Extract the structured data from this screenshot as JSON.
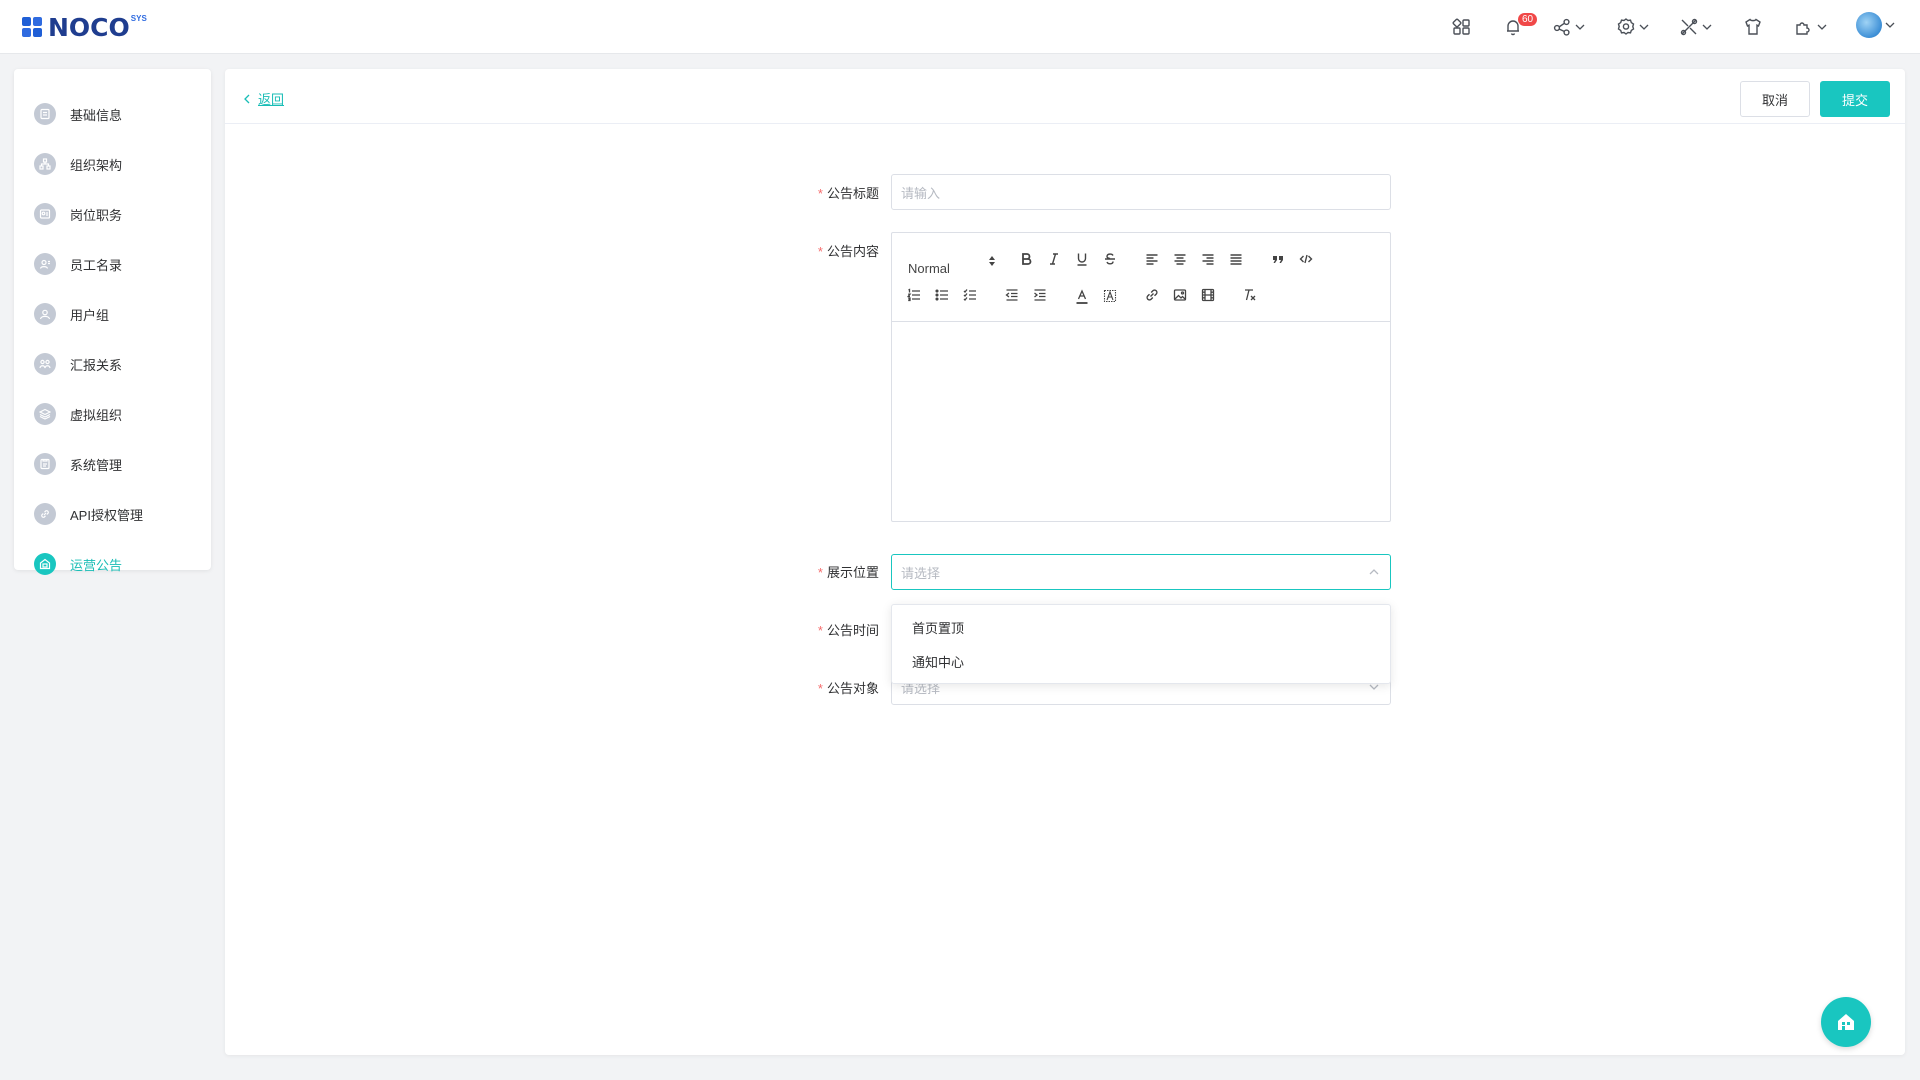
{
  "header": {
    "logo_text": "NOCO",
    "logo_sup": "SYS",
    "notification_count": "60",
    "icons": [
      "apps-grid-icon",
      "bell-icon",
      "share-icon",
      "settings-gear-icon",
      "tools-icon",
      "shirt-theme-icon",
      "plugin-icon",
      "user-avatar"
    ]
  },
  "sidebar": {
    "items": [
      {
        "label": "基础信息",
        "icon": "basic-info-icon"
      },
      {
        "label": "组织架构",
        "icon": "org-structure-icon"
      },
      {
        "label": "岗位职务",
        "icon": "position-icon"
      },
      {
        "label": "员工名录",
        "icon": "employee-directory-icon"
      },
      {
        "label": "用户组",
        "icon": "user-group-icon"
      },
      {
        "label": "汇报关系",
        "icon": "reporting-relation-icon"
      },
      {
        "label": "虚拟组织",
        "icon": "virtual-org-icon"
      },
      {
        "label": "系统管理",
        "icon": "system-management-icon"
      },
      {
        "label": "API授权管理",
        "icon": "api-auth-icon"
      },
      {
        "label": "运营公告",
        "icon": "announcement-icon",
        "active": true
      }
    ]
  },
  "main": {
    "back_label": "返回",
    "cancel_label": "取消",
    "submit_label": "提交",
    "required_mark": "*",
    "form": {
      "title_label": "公告标题",
      "title_placeholder": "请输入",
      "content_label": "公告内容",
      "position_label": "展示位置",
      "position_placeholder": "请选择",
      "time_label": "公告时间",
      "target_label": "公告对象",
      "target_placeholder": "请选择"
    },
    "editor": {
      "header_value": "Normal"
    },
    "dropdown_options": [
      "首页置顶",
      "通知中心"
    ]
  },
  "colors": {
    "accent": "#19c6c0",
    "required": "#f56c6c",
    "badge": "#f04848"
  }
}
